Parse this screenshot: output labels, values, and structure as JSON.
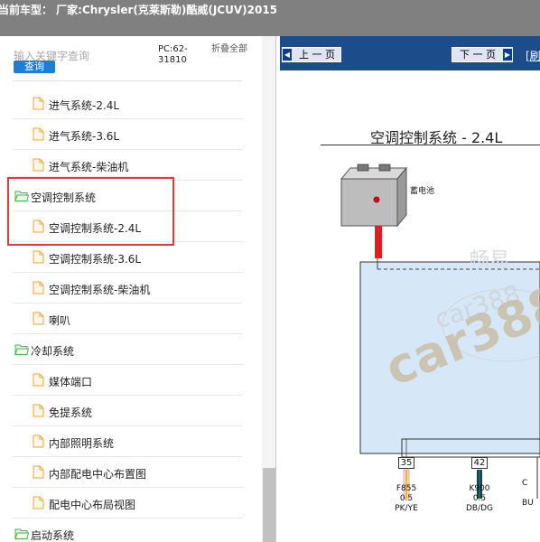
{
  "window": {
    "title": "当前车型： 厂家:Chrysler(克莱斯勒)酷威(JCUV)2015"
  },
  "sidebar": {
    "search_placeholder": "输入关键字查询",
    "query_button": "查询",
    "pc_code": "PC:62-31810",
    "fold_all": "折叠全部",
    "close": "×",
    "items": [
      {
        "label": "进气系统-2.4L",
        "type": "file"
      },
      {
        "label": "进气系统-3.6L",
        "type": "file"
      },
      {
        "label": "进气系统-柴油机",
        "type": "file"
      },
      {
        "label": "空调控制系统",
        "type": "folder"
      },
      {
        "label": "空调控制系统-2.4L",
        "type": "file"
      },
      {
        "label": "空调控制系统-3.6L",
        "type": "file"
      },
      {
        "label": "空调控制系统-柴油机",
        "type": "file"
      },
      {
        "label": "喇叭",
        "type": "file"
      },
      {
        "label": "冷却系统",
        "type": "folder"
      },
      {
        "label": "媒体端口",
        "type": "file"
      },
      {
        "label": "免提系统",
        "type": "file"
      },
      {
        "label": "内部照明系统",
        "type": "file"
      },
      {
        "label": "内部配电中心布置图",
        "type": "file"
      },
      {
        "label": "配电中心布局视图",
        "type": "file"
      },
      {
        "label": "启动系统",
        "type": "folder"
      }
    ]
  },
  "viewer": {
    "prev_page": "上 一 页",
    "next_page": "下 一 页",
    "refresh": "[刷",
    "diagram_title": "空调控制系统 - 2.4L",
    "battery_label": "蓄电池",
    "watermarks": [
      "畅易",
      "car388",
      "car388"
    ],
    "pins": [
      {
        "num": "35",
        "code": "F855",
        "size": "0.5",
        "color": "PK/YE"
      },
      {
        "num": "42",
        "code": "K900",
        "size": "0.5",
        "color": "DB/DG"
      },
      {
        "num": "",
        "code": "C",
        "size": "",
        "color": "BU"
      }
    ]
  },
  "colors": {
    "topbar": "#808080",
    "navbar": "#1d4c8a",
    "highlight_box": "#e53935",
    "query_button": "#1f7dd6",
    "module_fill": "#d6e8f7"
  }
}
